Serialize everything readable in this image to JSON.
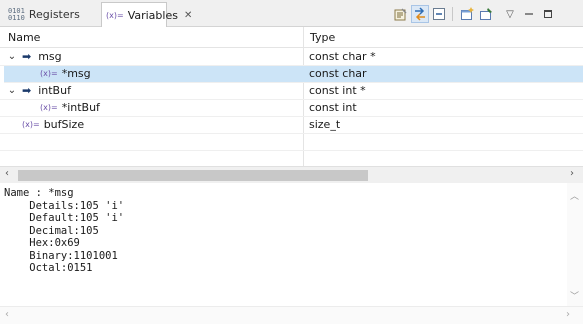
{
  "tabs": {
    "registers": {
      "icon_text": "0101\n0110",
      "label": "Registers"
    },
    "variables": {
      "icon_text": "(x)=",
      "label": "Variables",
      "close": "✕"
    }
  },
  "toolbar": {
    "buttons": [
      {
        "name": "show-type-names-icon",
        "glyph": "📝",
        "pressed": false
      },
      {
        "name": "show-logical-structure-icon",
        "glyph": "⇄",
        "pressed": true
      },
      {
        "name": "collapse-all-icon",
        "glyph": "⊟",
        "pressed": false
      },
      {
        "name": "new-view-icon",
        "glyph": "🗔",
        "pressed": false
      },
      {
        "name": "pin-icon",
        "glyph": "📌",
        "pressed": false
      },
      {
        "name": "view-menu-icon",
        "glyph": "▽",
        "pressed": false
      },
      {
        "name": "minimize-icon",
        "glyph": "—",
        "pressed": false
      },
      {
        "name": "maximize-icon",
        "glyph": "☐",
        "pressed": false
      }
    ]
  },
  "tree": {
    "columns": {
      "name": "Name",
      "type": "Type"
    },
    "rows": [
      {
        "name": "msg",
        "type": "const char *",
        "expanded": true,
        "pointer": true,
        "level": 0
      },
      {
        "name": "*msg",
        "type": "const char",
        "child": true,
        "level": 1,
        "selected": true
      },
      {
        "name": "intBuf",
        "type": "const int *",
        "expanded": true,
        "pointer": true,
        "level": 0
      },
      {
        "name": "*intBuf",
        "type": "const int",
        "child": true,
        "level": 1
      },
      {
        "name": "bufSize",
        "type": "size_t",
        "level": 0
      }
    ]
  },
  "detail": {
    "text": "Name : *msg\n    Details:105 'i'\n    Default:105 'i'\n    Decimal:105\n    Hex:0x69\n    Binary:1101001\n    Octal:0151"
  }
}
